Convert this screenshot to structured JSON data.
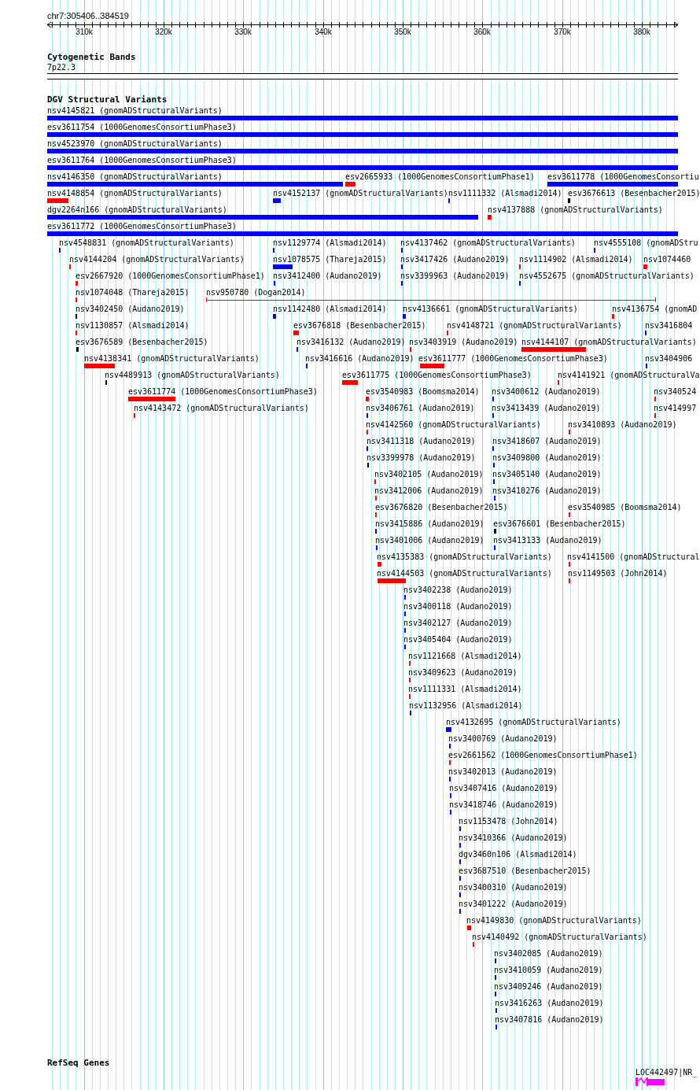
{
  "ruler": {
    "location": "chr7:305406..384519",
    "ticks": [
      "310k",
      "320k",
      "330k",
      "340k",
      "350k",
      "360k",
      "370k",
      "380k"
    ]
  },
  "tracks": [
    {
      "title": "Cytogenetic Bands",
      "bands": [
        "7p22.3"
      ]
    },
    {
      "title": "DGV Structural Variants",
      "features": [
        {
          "label": "nsv4145821 (gnomADStructuralVariants)",
          "color": "#0000ff"
        },
        {
          "label": "esv3611754 (1000GenomesConsortiumPhase3)",
          "color": "#0000ff"
        },
        {
          "label": "nsv4523970 (gnomADStructuralVariants)",
          "color": "#0000ff"
        },
        {
          "label": "esv3611764 (1000GenomesConsortiumPhase3)",
          "color": "#0000ff"
        },
        {
          "label": "nsv4146350 (gnomADStructuralVariants)",
          "color": "#0000ff"
        },
        {
          "label": "esv2665933 (1000GenomesConsortiumPhase1)",
          "color": "#ff0000"
        },
        {
          "label": "esv3611778 (1000GenomesConsortiu",
          "color": "#0000ff"
        },
        {
          "label": "nsv4148854 (gnomADStructuralVariants)",
          "color": "#ff0000"
        },
        {
          "label": "nsv4152137 (gnomADStructuralVariants)",
          "color": "#0000ff"
        },
        {
          "label": "nsv1111332 (Alsmadi2014)",
          "color": "#0000ff"
        },
        {
          "label": "esv3676613 (Besenbacher2015)",
          "color": "#000000"
        },
        {
          "label": "dgv2264n166 (gnomADStructuralVariants)",
          "color": "#0000ff"
        },
        {
          "label": "nsv4137888 (gnomADStructuralVariants)",
          "color": "#ff0000"
        },
        {
          "label": "esv3611772 (1000GenomesConsortiumPhase3)",
          "color": "#0000ff"
        },
        {
          "label": "nsv4548831 (gnomADStructuralVariants)",
          "color": "#0000ff"
        },
        {
          "label": "nsv1129774 (Alsmadi2014)",
          "color": "#0000ff"
        },
        {
          "label": "nsv4137462 (gnomADStructuralVariants)",
          "color": "#0000ff"
        },
        {
          "label": "nsv4555108 (gnomADStru",
          "color": "#0000ff"
        },
        {
          "label": "nsv4144204 (gnomADStructuralVariants)",
          "color": "#ff0000"
        },
        {
          "label": "nsv1078575 (Thareja2015)",
          "color": "#0000ff"
        },
        {
          "label": "nsv3417426 (Audano2019)",
          "color": "#0000ff"
        },
        {
          "label": "nsv1114902 (Alsmadi2014)",
          "color": "#ff0000"
        },
        {
          "label": "nsv1074460",
          "color": "#ff0000"
        },
        {
          "label": "esv2667920 (1000GenomesConsortiumPhase1)",
          "color": "#ff0000"
        },
        {
          "label": "nsv3412400 (Audano2019)",
          "color": "#0000ff"
        },
        {
          "label": "nsv3399963 (Audano2019)",
          "color": "#0000ff"
        },
        {
          "label": "nsv4552675 (gnomADStructuralVariants)",
          "color": "#0000ff"
        },
        {
          "label": "nsv1074048 (Thareja2015)",
          "color": "#ff0000"
        },
        {
          "label": "nsv950780 (Dogan2014)",
          "color": "#ff0000"
        },
        {
          "label": "nsv3402450 (Audano2019)",
          "color": "#000000"
        },
        {
          "label": "nsv1142480 (Alsmadi2014)",
          "color": "#0000ff"
        },
        {
          "label": "nsv4136661 (gnomADStructuralVariants)",
          "color": "#0000ff"
        },
        {
          "label": "nsv4136754 (gnomAD",
          "color": "#ff0000"
        },
        {
          "label": "nsv1130857 (Alsmadi2014)",
          "color": "#ff0000"
        },
        {
          "label": "esv3676818 (Besenbacher2015)",
          "color": "#ff0000"
        },
        {
          "label": "nsv4148721 (gnomADStructuralVariants)",
          "color": "#ff0000"
        },
        {
          "label": "nsv3416804",
          "color": "#0000ff"
        },
        {
          "label": "esv3676589 (Besenbacher2015)",
          "color": "#000000"
        },
        {
          "label": "nsv3416132 (Audano2019)",
          "color": "#0000ff"
        },
        {
          "label": "nsv3403919 (Audano2019)",
          "color": "#ff0000"
        },
        {
          "label": "nsv4144107 (gnomADStructuralVariants)",
          "color": "#ff0000"
        },
        {
          "label": "nsv4138341 (gnomADStructuralVariants)",
          "color": "#ff0000"
        },
        {
          "label": "nsv3416616 (Audano2019)",
          "color": "#0000ff"
        },
        {
          "label": "esv3611777 (1000GenomesConsortiumPhase3)",
          "color": "#ff0000"
        },
        {
          "label": "nsv3404906",
          "color": "#0000ff"
        },
        {
          "label": "nsv4489913 (gnomADStructuralVariants)",
          "color": "#000000"
        },
        {
          "label": "esv3611775 (1000GenomesConsortiumPhase3)",
          "color": "#ff0000"
        },
        {
          "label": "nsv4141921 (gnomADStructuralVa",
          "color": "#ff0000"
        },
        {
          "label": "esv3611774 (1000GenomesConsortiumPhase3)",
          "color": "#ff0000"
        },
        {
          "label": "esv3540983 (Boomsma2014)",
          "color": "#ff0000"
        },
        {
          "label": "nsv3400612 (Audano2019)",
          "color": "#0000ff"
        },
        {
          "label": "nsv340524",
          "color": "#ff0000"
        },
        {
          "label": "nsv4143472 (gnomADStructuralVariants)",
          "color": "#ff0000"
        },
        {
          "label": "nsv3406761 (Audano2019)",
          "color": "#0000ff"
        },
        {
          "label": "nsv3413439 (Audano2019)",
          "color": "#0000ff"
        },
        {
          "label": "nsv414997",
          "color": "#ff0000"
        },
        {
          "label": "nsv4142560 (gnomADStructuralVariants)",
          "color": "#ff0000"
        },
        {
          "label": "nsv3410893 (Audano2019)",
          "color": "#ff0000"
        },
        {
          "label": "nsv3411318 (Audano2019)",
          "color": "#0000ff"
        },
        {
          "label": "nsv3418607 (Audano2019)",
          "color": "#0000ff"
        },
        {
          "label": "nsv3399978 (Audano2019)",
          "color": "#000000"
        },
        {
          "label": "nsv3409800 (Audano2019)",
          "color": "#0000ff"
        },
        {
          "label": "nsv3402105 (Audano2019)",
          "color": "#ff0000"
        },
        {
          "label": "nsv3405140 (Audano2019)",
          "color": "#0000ff"
        },
        {
          "label": "nsv3412006 (Audano2019)",
          "color": "#ff0000"
        },
        {
          "label": "nsv3410276 (Audano2019)",
          "color": "#0000ff"
        },
        {
          "label": "esv3676820 (Besenbacher2015)",
          "color": "#ff0000"
        },
        {
          "label": "esv3540985 (Boomsma2014)",
          "color": "#ff0000"
        },
        {
          "label": "nsv3415886 (Audano2019)",
          "color": "#0000ff"
        },
        {
          "label": "esv3676601 (Besenbacher2015)",
          "color": "#000000"
        },
        {
          "label": "nsv3401006 (Audano2019)",
          "color": "#0000ff"
        },
        {
          "label": "nsv3413133 (Audano2019)",
          "color": "#0000ff"
        },
        {
          "label": "nsv4135383 (gnomADStructuralVariants)",
          "color": "#ff0000"
        },
        {
          "label": "nsv4141500 (gnomADStructural",
          "color": "#ff0000"
        },
        {
          "label": "nsv4144503 (gnomADStructuralVariants)",
          "color": "#ff0000"
        },
        {
          "label": "nsv1149503 (John2014)",
          "color": "#ff0000"
        },
        {
          "label": "nsv3402238 (Audano2019)",
          "color": "#0000ff"
        },
        {
          "label": "nsv3400118 (Audano2019)",
          "color": "#0000ff"
        },
        {
          "label": "nsv3402127 (Audano2019)",
          "color": "#0000ff"
        },
        {
          "label": "nsv3405404 (Audano2019)",
          "color": "#0000ff"
        },
        {
          "label": "nsv1121668 (Alsmadi2014)",
          "color": "#ff0000"
        },
        {
          "label": "nsv3409623 (Audano2019)",
          "color": "#ff0000"
        },
        {
          "label": "nsv1111331 (Alsmadi2014)",
          "color": "#ff0000"
        },
        {
          "label": "nsv1132956 (Alsmadi2014)",
          "color": "#0000ff"
        },
        {
          "label": "nsv4132695 (gnomADStructuralVariants)",
          "color": "#0000ff"
        },
        {
          "label": "nsv3400769 (Audano2019)",
          "color": "#0000ff"
        },
        {
          "label": "esv2661562 (1000GenomesConsortiumPhase1)",
          "color": "#ff0000"
        },
        {
          "label": "nsv3402013 (Audano2019)",
          "color": "#0000ff"
        },
        {
          "label": "nsv3407416 (Audano2019)",
          "color": "#0000ff"
        },
        {
          "label": "nsv3418746 (Audano2019)",
          "color": "#0000ff"
        },
        {
          "label": "nsv1153478 (John2014)",
          "color": "#0000ff"
        },
        {
          "label": "nsv3410366 (Audano2019)",
          "color": "#0000ff"
        },
        {
          "label": "dgv3460n106 (Alsmadi2014)",
          "color": "#0000ff"
        },
        {
          "label": "esv3687510 (Besenbacher2015)",
          "color": "#0000ff"
        },
        {
          "label": "nsv3400310 (Audano2019)",
          "color": "#0000ff"
        },
        {
          "label": "nsv3401222 (Audano2019)",
          "color": "#0000ff"
        },
        {
          "label": "nsv4149830 (gnomADStructuralVariants)",
          "color": "#ff0000"
        },
        {
          "label": "nsv4140492 (gnomADStructuralVariants)",
          "color": "#ff0000"
        },
        {
          "label": "nsv3402085 (Audano2019)",
          "color": "#0000ff"
        },
        {
          "label": "nsv3410059 (Audano2019)",
          "color": "#0000ff"
        },
        {
          "label": "nsv3409246 (Audano2019)",
          "color": "#0000ff"
        },
        {
          "label": "nsv3416263 (Audano2019)",
          "color": "#0000ff"
        },
        {
          "label": "nsv3407816 (Audano2019)",
          "color": "#0000ff"
        }
      ]
    },
    {
      "title": "RefSeq Genes",
      "features": [
        {
          "label": "LOC442497|NR_"
        }
      ]
    }
  ]
}
